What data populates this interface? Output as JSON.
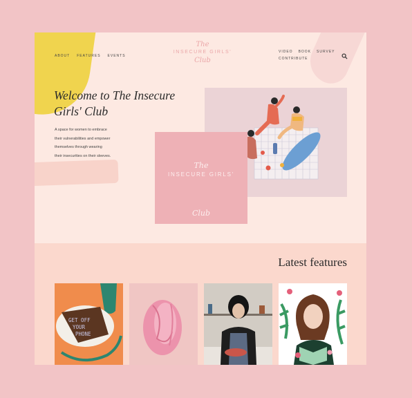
{
  "nav": {
    "left": [
      "ABOUT",
      "FEATURES",
      "EVENTS"
    ],
    "right": [
      "VIDEO",
      "BOOK",
      "SURVEY",
      "CONTRIBUTE"
    ]
  },
  "logo": {
    "script_top": "The",
    "main": "INSECURE GIRLS'",
    "script_bottom": "Club"
  },
  "hero": {
    "title_line1": "Welcome to The Insecure",
    "title_line2": "Girls' Club",
    "text_lines": [
      "A space for women to embrace",
      "their vulnerabilities and empower",
      "themselves through wearing",
      "their insecurities on their sleeves."
    ]
  },
  "card": {
    "script_top": "The",
    "main": "INSECURE GIRLS'",
    "script_bottom": "Club"
  },
  "cake": {
    "line1": "GET OFF",
    "line2": "YOUR",
    "line3": "PHONE"
  },
  "features": {
    "title": "Latest features"
  },
  "colors": {
    "background": "#f2c4c6",
    "page": "#fde9e2",
    "features_band": "#fbd8cd",
    "accent_pink": "#eeb1b6",
    "accent_yellow": "#f0d44e"
  }
}
